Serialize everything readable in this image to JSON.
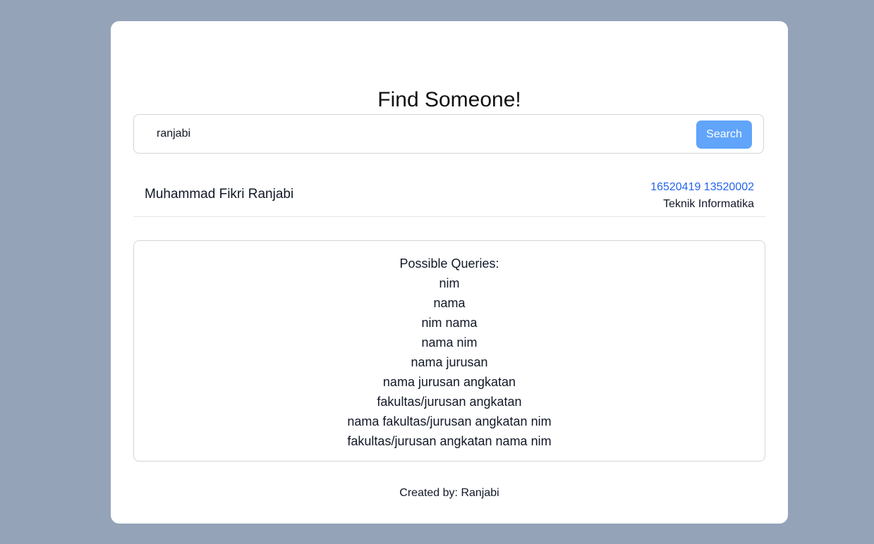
{
  "page": {
    "title": "Find Someone!"
  },
  "search": {
    "value": "ranjabi",
    "placeholder": "",
    "button_label": "Search"
  },
  "results": [
    {
      "name": "Muhammad Fikri Ranjabi",
      "nims": "16520419 13520002",
      "major": "Teknik Informatika"
    }
  ],
  "queries": {
    "title": "Possible Queries:",
    "items": [
      "nim",
      "nama",
      "nim nama",
      "nama nim",
      "nama jurusan",
      "nama jurusan angkatan",
      "fakultas/jurusan angkatan",
      "nama fakultas/jurusan angkatan nim",
      "fakultas/jurusan angkatan nama nim"
    ]
  },
  "footer": {
    "text": "Created by: Ranjabi"
  },
  "colors": {
    "background": "#94a3b8",
    "card": "#ffffff",
    "button": "#60a5fa",
    "link": "#2563eb"
  }
}
